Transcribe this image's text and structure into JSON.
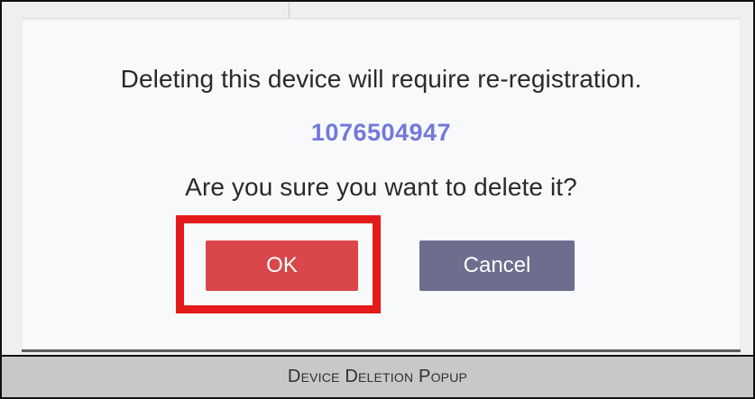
{
  "dialog": {
    "message": "Deleting this device will require re-registration.",
    "device_id": "1076504947",
    "question": "Are you sure you want to delete it?",
    "ok_label": "OK",
    "cancel_label": "Cancel"
  },
  "caption": {
    "text": "Device Deletion Popup"
  },
  "colors": {
    "device_id": "#7378d9",
    "ok_button": "#d9474a",
    "cancel_button": "#6d6d8d",
    "highlight": "#e31b1b",
    "caption_background": "#c8c8c8"
  }
}
